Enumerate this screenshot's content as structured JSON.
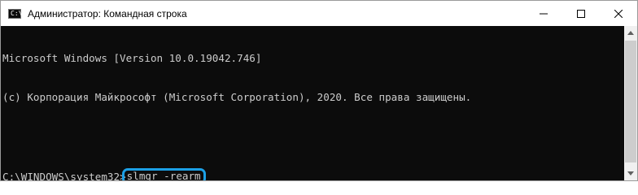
{
  "window": {
    "title": "Администратор: Командная строка",
    "icon": "cmd-icon",
    "icon_glyph": "C:\\",
    "controls": [
      "minimize-icon",
      "maximize-icon",
      "close-icon"
    ]
  },
  "console": {
    "lines": [
      "Microsoft Windows [Version 10.0.19042.746]",
      "(c) Корпорация Майкрософт (Microsoft Corporation), 2020. Все права защищены.",
      ""
    ],
    "prompt": "C:\\WINDOWS\\system32>",
    "command": "slmgr -rearm",
    "highlight_color": "#1ca0e6",
    "text_color": "#cccccc",
    "background": "#0c0c0c"
  }
}
